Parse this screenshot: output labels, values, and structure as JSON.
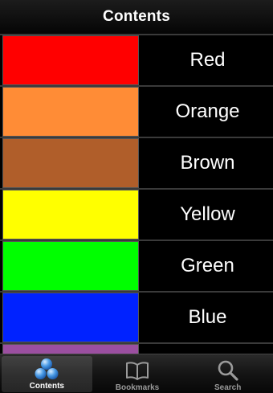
{
  "header": {
    "title": "Contents"
  },
  "colors": [
    {
      "label": "Red",
      "swatch": "#ff0000"
    },
    {
      "label": "Orange",
      "swatch": "#ff8c36"
    },
    {
      "label": "Brown",
      "swatch": "#b05e2a"
    },
    {
      "label": "Yellow",
      "swatch": "#ffff00"
    },
    {
      "label": "Green",
      "swatch": "#00ff00"
    },
    {
      "label": "Blue",
      "swatch": "#0022ff"
    },
    {
      "label": "",
      "swatch": "#9b4fa0"
    }
  ],
  "tabs": [
    {
      "label": "Contents",
      "icon": "contents-icon",
      "active": true
    },
    {
      "label": "Bookmarks",
      "icon": "book-icon",
      "active": false
    },
    {
      "label": "Search",
      "icon": "search-icon",
      "active": false
    }
  ]
}
